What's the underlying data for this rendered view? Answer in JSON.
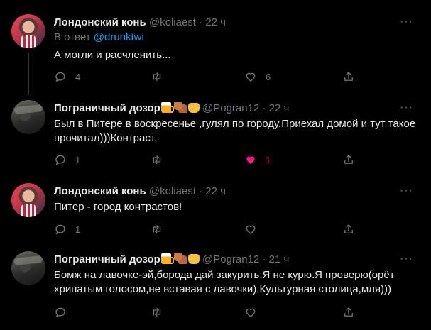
{
  "colors": {
    "background": "#000000",
    "text": "#e7e9ea",
    "muted": "#71767b",
    "link": "#1d9bf0",
    "like_active": "#f91880"
  },
  "tweets": [
    {
      "name": "Лондонский конь",
      "handle": "@koliaest",
      "dot": "·",
      "time": "22 ч",
      "reply_prefix": "В ответ",
      "reply_handle": "@drunktwi",
      "text": "А могли и расчленить...",
      "reply_count": "4",
      "retweet_count": "",
      "like_count": "6",
      "liked": false,
      "avatar": "pink-avatar",
      "name_emoji": []
    },
    {
      "name": "Пограничный дозор",
      "handle": "@Pogran12",
      "dot": "·",
      "time": "22 ч",
      "text": "Был в Питере в воскресенье ,гулял по городу.Приехал домой и тут такое прочитал)))Контраст.",
      "reply_count": "1",
      "retweet_count": "",
      "like_count": "1",
      "liked": true,
      "avatar": "car-avatar",
      "name_emoji": [
        "beer-mug-icon",
        "flexed-arm-icon",
        "fist-icon"
      ]
    },
    {
      "name": "Лондонский конь",
      "handle": "@koliaest",
      "dot": "·",
      "time": "22 ч",
      "text": "Питер - город контрастов!",
      "reply_count": "1",
      "retweet_count": "",
      "like_count": "",
      "liked": false,
      "avatar": "pink-avatar",
      "name_emoji": []
    },
    {
      "name": "Пограничный дозор",
      "handle": "@Pogran12",
      "dot": "·",
      "time": "21 ч",
      "text": "Бомж на лавочке-эй,борода дай закурить.Я не курю.Я проверю(орёт хрипатым голосом,не вставая с лавочки).Культурная столица,мля)))",
      "reply_count": "",
      "retweet_count": "",
      "like_count": "",
      "liked": false,
      "avatar": "car-avatar",
      "name_emoji": [
        "beer-mug-icon",
        "flexed-arm-icon",
        "fist-icon"
      ]
    }
  ],
  "icons": {
    "reply": "speech-bubble-icon",
    "retweet": "retweet-arrows-icon",
    "like": "heart-icon",
    "share": "share-upload-icon",
    "more": "more-dots-icon"
  },
  "more_label": "···"
}
